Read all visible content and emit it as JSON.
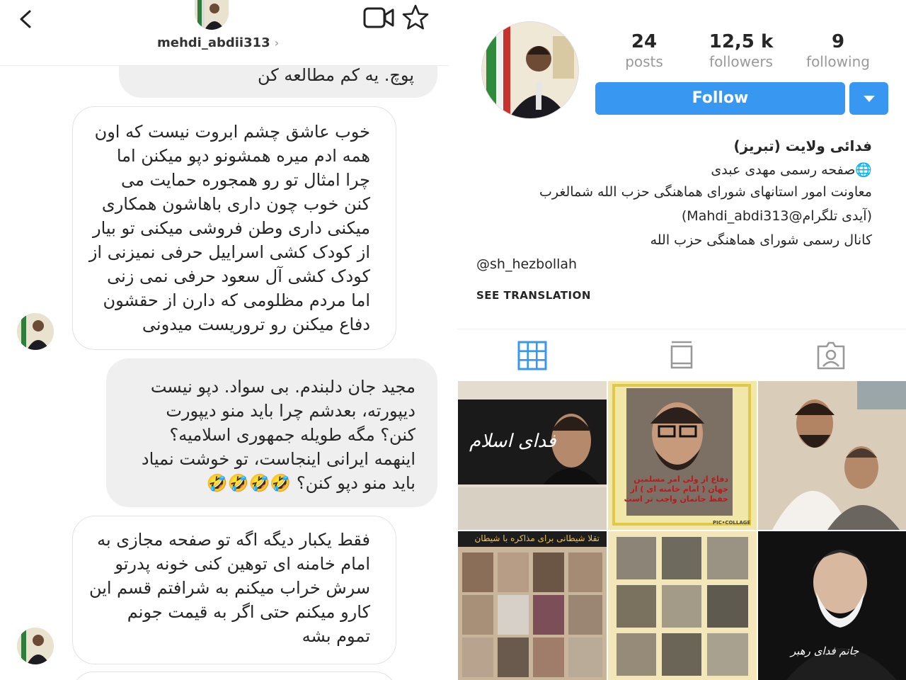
{
  "chat": {
    "username": "mehdi_abdii313",
    "top_fragment": "پوچ. یه کم مطالعه کن",
    "messages": [
      {
        "from": "them",
        "text": "خوب عاشق چشم ابروت نیست که اون\nهمه ادم میره همشونو دپو میکنن اما\nچرا امثال تو رو همجوره حمایت می\nکنن خوب چون داری باهاشون همکاری\nمیکنی داری وطن فروشی میکنی تو بیار\nاز کودک کشی اسراییل حرفی نمیزنی از\nکودک کشی آل سعود حرفی نمی زنی\nاما مردم مظلومی که دارن از حقشون\nدفاع میکنن رو تروریست میدونی"
      },
      {
        "from": "me",
        "text": "مجید جان دلبندم. بی سواد. دپو نیست\nدیپورته، بعدشم چرا باید منو دیپورت\nکنن؟ مگه طویله جمهوری اسلامیه؟\nاینهمه ایرانی اینجاست، تو خوشت نمیاد\nباید منو دپو کنن؟ 🤣🤣🤣🤣"
      },
      {
        "from": "them",
        "text": "فقط یکبار دیگه اگه تو صفحه مجازی به\nامام خامنه ای توهین کنی خونه پدرتو\nسرش خراب میکنم به شرافتم قسم این\nکارو میکنم حتی اگر به قیمت جونم\nتموم بشه"
      }
    ]
  },
  "profile": {
    "stats": [
      {
        "value": "24",
        "label": "posts"
      },
      {
        "value": "12,5 k",
        "label": "followers"
      },
      {
        "value": "9",
        "label": "following"
      }
    ],
    "follow_label": "Follow",
    "display_name": "فدائی ولایت (تبریز)",
    "bio_lines": [
      "🌐صفحه رسمی مهدی عبدی",
      "معاونت امور استانهای شورای هماهنگی حزب الله شمالغرب",
      "(آیدی تلگرام@Mahdi_abdi313)",
      "کانال رسمی شورای هماهنگی حزب الله",
      "@sh_hezbollah"
    ],
    "see_translation": "SEE TRANSLATION",
    "posts": [
      {
        "caption": "فدای اسلام"
      },
      {
        "caption": "دفاع از ولی امر مسلمین جهان ( امام خامنه ای ) از حفظ جانمان واجب تر است",
        "watermark": "PIC•COLLAGE"
      },
      {
        "caption": ""
      },
      {
        "caption": "تقلا شیطانی برای مذاکره با شیطان"
      },
      {
        "caption": ""
      },
      {
        "caption": "جانم فدای رهبر"
      }
    ]
  },
  "colors": {
    "accent": "#3897f0",
    "bubble_mine": "#efefef",
    "text": "#262626",
    "muted": "#999999"
  }
}
